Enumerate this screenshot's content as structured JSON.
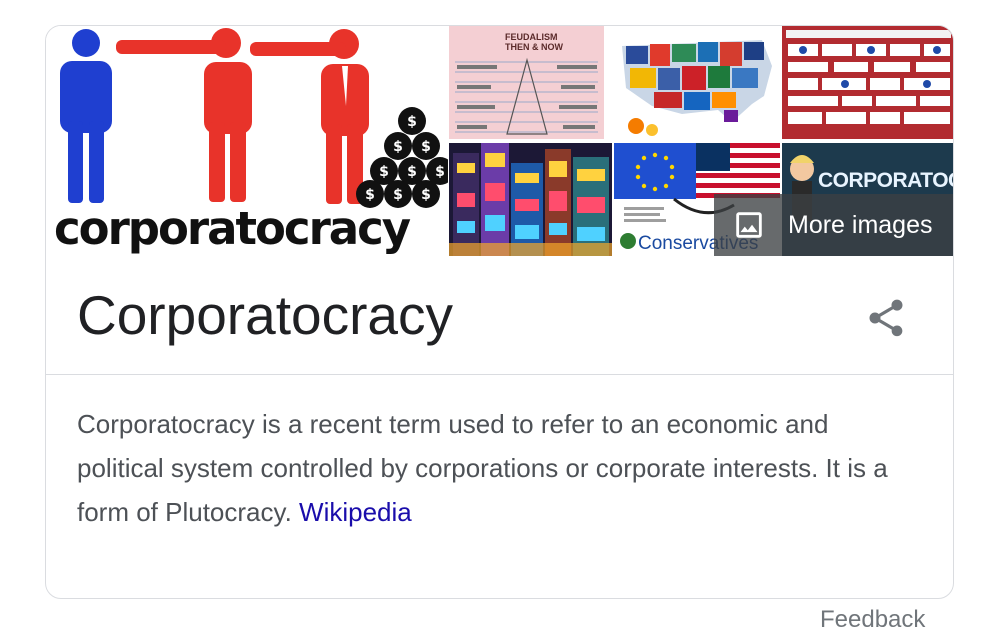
{
  "images": {
    "main_logo_text": "corporatocracy",
    "tile_feudalism_title": "FEUDALISM",
    "tile_feudalism_subtitle": "THEN & NOW",
    "tile_conservatives_text": "Conservatives",
    "tile_cartoon_text": "CORPORATOCRACY",
    "more_images_label": "More images"
  },
  "panel": {
    "title": "Corporatocracy",
    "description": "Corporatocracy is a recent term used to refer to an economic and political system controlled by corporations or corporate interests. It is a form of Plutocracy. ",
    "source_link": "Wikipedia"
  },
  "footer": {
    "feedback": "Feedback"
  },
  "colors": {
    "title": "#202124",
    "body_text": "#4d5156",
    "link": "#1a0dab",
    "border": "#dadce0",
    "figure_blue": "#1f3fd0",
    "figure_red": "#e8332a"
  },
  "icons": {
    "image": "image-icon",
    "share": "share-icon"
  }
}
